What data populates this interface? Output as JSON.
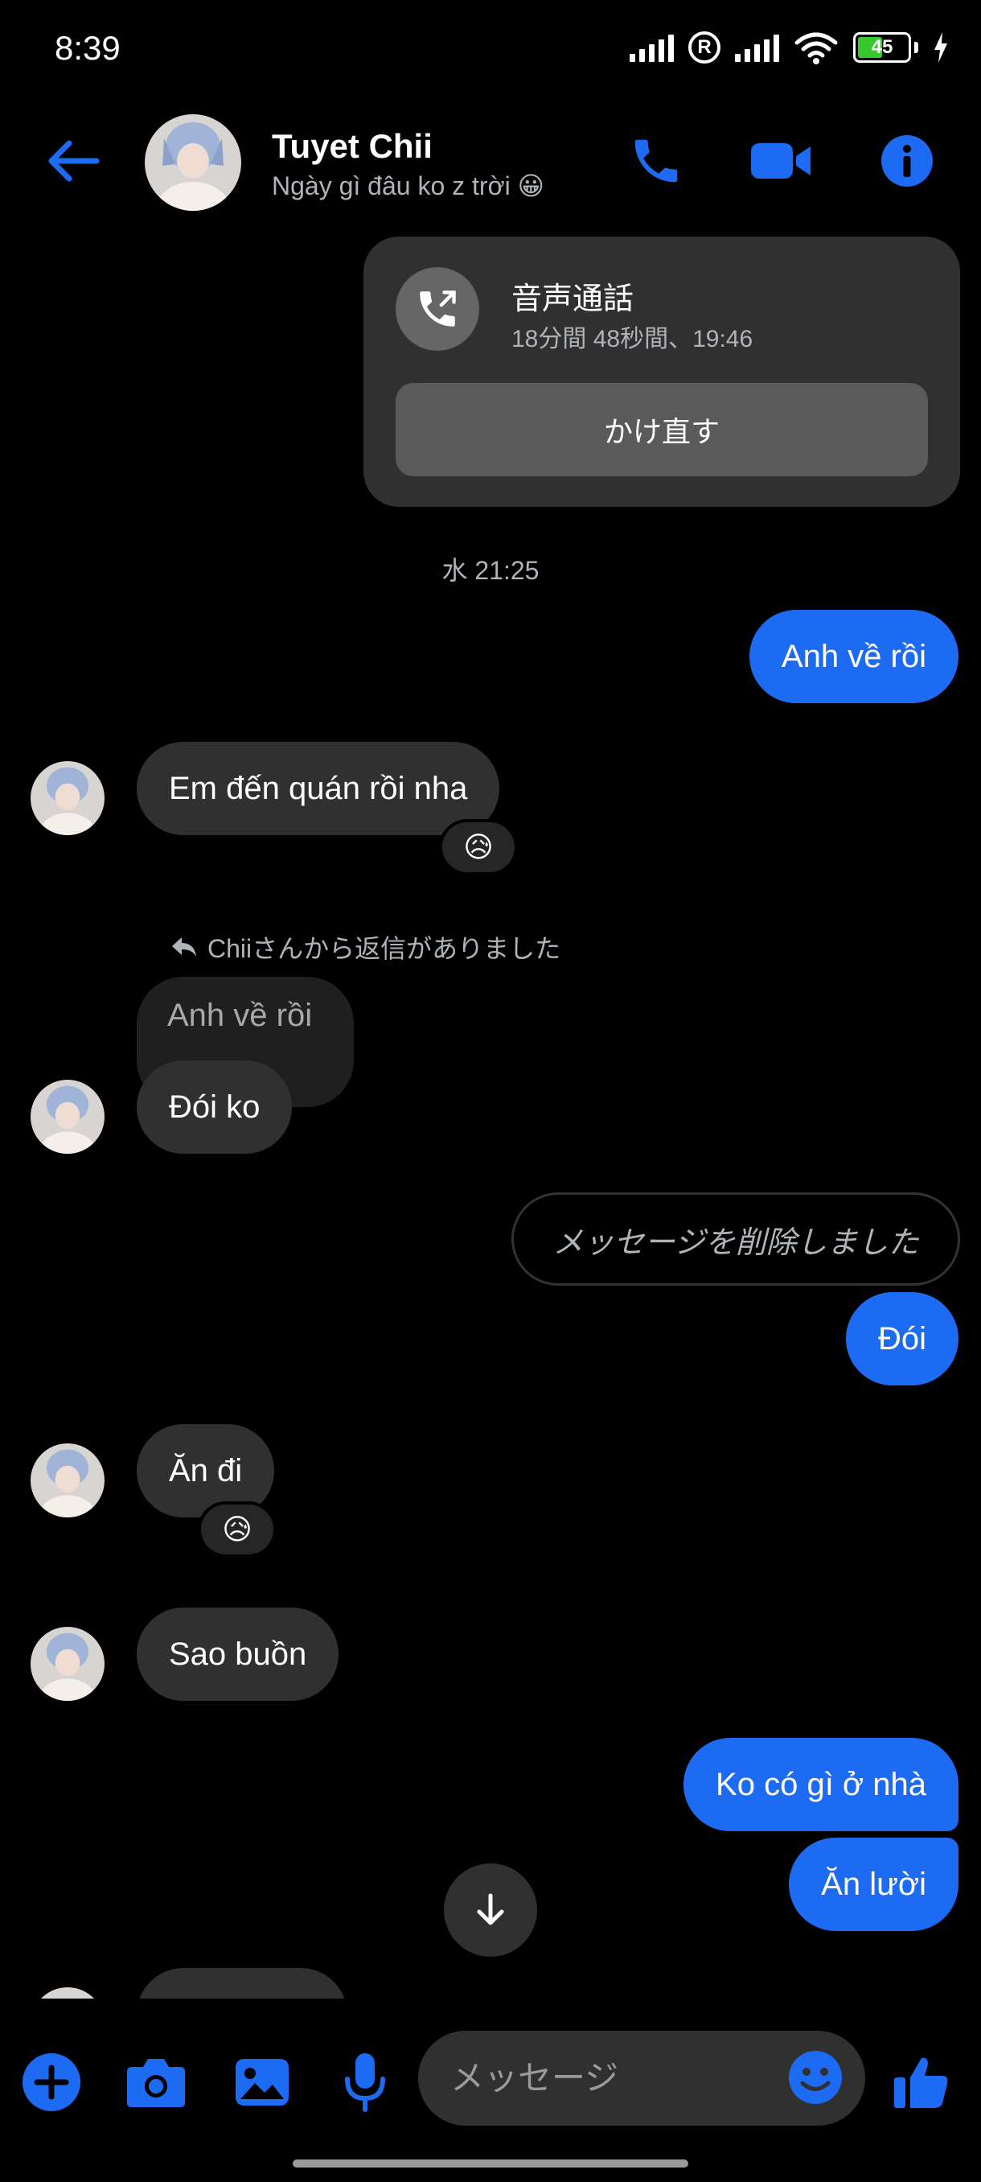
{
  "status_bar": {
    "time": "8:39",
    "battery": "45",
    "wifi_label": "6"
  },
  "header": {
    "contact_name": "Tuyet Chii",
    "contact_status": "Ngày gì đâu ko z trời 😀",
    "accent": "#1d6bf3"
  },
  "call_card": {
    "title": "音声通話",
    "subtitle": "18分間 48秒間、19:46",
    "button_label": "かけ直す"
  },
  "timestamp": "水 21:25",
  "messages": {
    "m1": "Anh về rồi",
    "m2": "Em đến quán rồi nha",
    "m2_reaction": "😥",
    "reply_note": "Chiiさんから返信がありました",
    "replied_text": "Anh về rồi",
    "m3": "Đói ko",
    "deleted_text": "メッセージを削除しました",
    "m4": "Đói",
    "m5": "Ăn đi",
    "m5_reaction": "😥",
    "m6": "Sao buồn",
    "m7": "Ko có gì ở nhà",
    "m8": "Ăn lười"
  },
  "composer": {
    "placeholder": "メッセージ"
  },
  "colors": {
    "outgoing": "#1d6bf3",
    "incoming": "#303030",
    "background": "#000000"
  }
}
